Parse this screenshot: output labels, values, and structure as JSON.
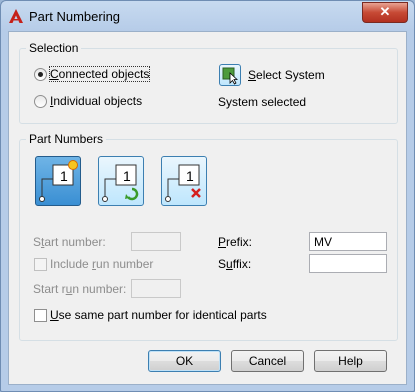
{
  "window": {
    "title": "Part Numbering",
    "close_label": "✕"
  },
  "selection": {
    "group_label": "Selection",
    "connected_objects": "Connected objects",
    "individual_objects": "Individual objects",
    "select_system": "Select System",
    "status": "System selected",
    "selected_mode": "connected"
  },
  "part_numbers": {
    "group_label": "Part Numbers",
    "buttons": [
      {
        "name": "new-part-number",
        "number": "1",
        "badge": "new"
      },
      {
        "name": "renumber-part-number",
        "number": "1",
        "badge": "refresh"
      },
      {
        "name": "remove-part-number",
        "number": "1",
        "badge": "delete"
      }
    ],
    "start_number_label": "Start number:",
    "start_number_value": "",
    "include_run_number_label": "Include run number",
    "start_run_number_label": "Start run number:",
    "start_run_number_value": "",
    "prefix_label": "Prefix:",
    "prefix_value": "MV",
    "suffix_label": "Suffix:",
    "suffix_value": "",
    "same_part_number_label": "Use same part number for identical parts"
  },
  "footer": {
    "ok": "OK",
    "cancel": "Cancel",
    "help": "Help"
  },
  "colors": {
    "accent": "#3a8fd3",
    "disabled_text": "#8d8d8d"
  }
}
